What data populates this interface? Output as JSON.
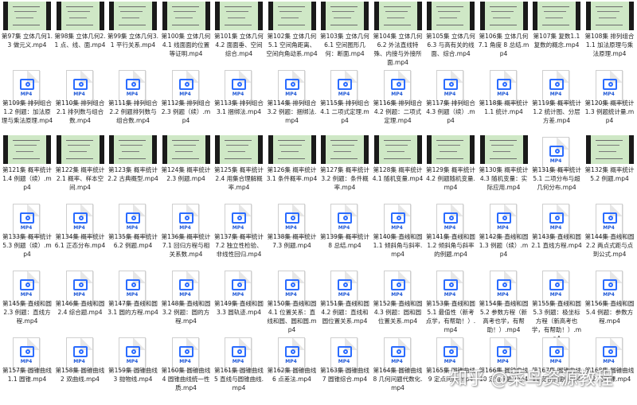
{
  "watermark": "知乎 @菜鸟资源教程",
  "rows": [
    [
      {
        "label": "第97集 立体几何1.3 做元义.mp4",
        "kind": "video"
      },
      {
        "label": "第98集 立体几何2.1 点、线、面.mp4",
        "kind": "video"
      },
      {
        "label": "第99集 立体几何3.1 平行关系.mp4",
        "kind": "video"
      },
      {
        "label": "第100集 立体几何4.1 线面面的位置等证明.mp4",
        "kind": "video"
      },
      {
        "label": "第101集 立体几何4.2 面面垂、空间综合.mp4",
        "kind": "video"
      },
      {
        "label": "第102集 立体几何5.1 空间角距离、空间向角动系.mp4",
        "kind": "video"
      },
      {
        "label": "第103集 立体几何6.1 空间图形几何：断面.mp4",
        "kind": "video"
      },
      {
        "label": "第104集 立体几何6.2 外法直线特殊、内接与外接所面.mp4",
        "kind": "video"
      },
      {
        "label": "第105集 立体几何6.3 与高有关的线面、综合.mp4",
        "kind": "video"
      },
      {
        "label": "第106集 立体几何7.1 角度 8 总结.mp4",
        "kind": "video"
      },
      {
        "label": "第107集 复数1.1 复数的概念.mp4",
        "kind": "video"
      },
      {
        "label": "第108集 排列组合1.1 加法原理与乘法原理.mp4",
        "kind": "video"
      }
    ],
    [
      {
        "label": "第109集 排列组合1.2 例题：加法原理与乘法原理.mp4",
        "kind": "file"
      },
      {
        "label": "第110集 排列组合2.1 排列数与组合数.mp4",
        "kind": "file"
      },
      {
        "label": "第111集 排列组合2.2 例题排列数与组合数.mp4",
        "kind": "file"
      },
      {
        "label": "第112集 排列组合2.3 例题（续）.mp4",
        "kind": "file"
      },
      {
        "label": "第113集 排列组合3.1 捆绑法.mp4",
        "kind": "file"
      },
      {
        "label": "第114集 排列组合3.2 例题：捆绑法.mp4",
        "kind": "file"
      },
      {
        "label": "第115集 排列组合4.1 二项式定理.mp4",
        "kind": "file"
      },
      {
        "label": "第116集 排列组合4.2 例题：二项式定理.mp4",
        "kind": "file"
      },
      {
        "label": "第117集 排列组合4.3 例题（续）.mp4",
        "kind": "file"
      },
      {
        "label": "第118集 概率统计1.1 统计.mp4",
        "kind": "file"
      },
      {
        "label": "第119集 概率统计1.2 统计图、分层方差.mp4",
        "kind": "file"
      },
      {
        "label": "第120集 概率统计1.3 例题统计量.mp4",
        "kind": "file"
      }
    ],
    [
      {
        "label": "第121集 概率统计1.4 例题（续）.mp4",
        "kind": "video"
      },
      {
        "label": "第122集 概率统计2.1 概率、样本空间.mp4",
        "kind": "video"
      },
      {
        "label": "第123集 概率统计2.2 古典概型.mp4",
        "kind": "video"
      },
      {
        "label": "第124集 概率统计2.3 例题.mp4",
        "kind": "video"
      },
      {
        "label": "第125集 概率统计2.4 用集合理解概率.mp4",
        "kind": "video"
      },
      {
        "label": "第126集 概率统计3.1 条件概率.mp4",
        "kind": "video"
      },
      {
        "label": "第127集 概率统计3.2 例题：条件概率.mp4",
        "kind": "video"
      },
      {
        "label": "第128集 概率统计4.1 随机变量.mp4",
        "kind": "video"
      },
      {
        "label": "第129集 概率统计4.2 例题随机变量.mp4",
        "kind": "video"
      },
      {
        "label": "第130集 概率统计4.3 随机变量：实际应用.mp4",
        "kind": "video"
      },
      {
        "label": "第131集 概率统计5.1 二项分布与超几何分布.mp4",
        "kind": "file"
      },
      {
        "label": "第132集 概率统计5.2 例题.mp4",
        "kind": "video"
      }
    ],
    [
      {
        "label": "第133集 概率统计5.3 例题（续）.mp4",
        "kind": "file"
      },
      {
        "label": "第134集 概率统计6.1 正态分布.mp4",
        "kind": "file"
      },
      {
        "label": "第135集 概率统计6.2 例题.mp4",
        "kind": "file"
      },
      {
        "label": "第136集 概率统计7.1 回归方程与相关系数.mp4",
        "kind": "file"
      },
      {
        "label": "第137集 概率统计7.2 独立性检验、非线性回归.mp4",
        "kind": "file"
      },
      {
        "label": "第138集 概率统计7.3 例题.mp4",
        "kind": "file"
      },
      {
        "label": "第139集 概率统计8 总结.mp4",
        "kind": "file"
      },
      {
        "label": "第140集 直线和圆1.1 倾斜角与斜率.mp4",
        "kind": "file"
      },
      {
        "label": "第141集 直线和圆1.2 倾斜角与斜率的例题.mp4",
        "kind": "file"
      },
      {
        "label": "第142集 直线和圆1.3 例题（续）.mp4",
        "kind": "file"
      },
      {
        "label": "第143集 直线和圆2.1 直线方程.mp4",
        "kind": "file"
      },
      {
        "label": "第144集 直线和圆2.2 两点式距与点到公式.mp4",
        "kind": "file"
      }
    ],
    [
      {
        "label": "第145集 直线和圆2.3 例题：直线方程.mp4",
        "kind": "file"
      },
      {
        "label": "第146集 直线和圆2.4 综合题.mp4",
        "kind": "file"
      },
      {
        "label": "第147集 直线和圆3.1 圆的方程.mp4",
        "kind": "file"
      },
      {
        "label": "第148集 直线和圆3.2 例题：圆的方程.mp4",
        "kind": "file"
      },
      {
        "label": "第149集 直线和圆3.3 圆轨迹.mp4",
        "kind": "file"
      },
      {
        "label": "第150集 直线和圆4.1 位置关系：直线和圆、圆和圆.mp4",
        "kind": "file"
      },
      {
        "label": "第151集 直线和圆4.2 例题：直线和圆位置关系.mp4",
        "kind": "file"
      },
      {
        "label": "第152集 直线和圆4.3 例题：圆和圆位置关系.mp4",
        "kind": "file"
      },
      {
        "label": "第153集 直线和圆5.1 最值性（新考点学，有帮助！）.mp4",
        "kind": "file"
      },
      {
        "label": "第154集 直线和圆5.2 参数方程（新高考也学，有帮助！）.mp4",
        "kind": "file"
      },
      {
        "label": "第155集 直线和圆5.3 例题：极坐标方程（新高考也学，有帮助！）.mp4",
        "kind": "file"
      },
      {
        "label": "第156集 直线和圆5.4 例题：参数方程.mp4",
        "kind": "file"
      }
    ],
    [
      {
        "label": "第157集 圆锥曲线1.1 圆锥.mp4",
        "kind": "file"
      },
      {
        "label": "第158集 圆锥曲线2 双曲线.mp4",
        "kind": "file"
      },
      {
        "label": "第159集 圆锥曲线3 抛物线.mp4",
        "kind": "file"
      },
      {
        "label": "第160集 圆锥曲线4 圆锥曲线统一性质.mp4",
        "kind": "file"
      },
      {
        "label": "第161集 圆锥曲线5 直线与圆锥曲线.mp4",
        "kind": "file"
      },
      {
        "label": "第162集 圆锥曲线6 点差法.mp4",
        "kind": "file"
      },
      {
        "label": "第163集 圆锥曲线7 圆锥综合.mp4",
        "kind": "file"
      },
      {
        "label": "第164集 圆锥曲线8 几何问题代数化.mp4",
        "kind": "file"
      },
      {
        "label": "第165集 圆锥曲线9 定点问题.mp4",
        "kind": "file"
      },
      {
        "label": "第166集 圆锥曲线10 定值问题.mp4",
        "kind": "file"
      },
      {
        "label": "第167集 圆锥曲线11 范围问题.mp4",
        "kind": "file"
      },
      {
        "label": "第168集 圆锥曲线12 习题课.mp4",
        "kind": "file"
      }
    ]
  ]
}
